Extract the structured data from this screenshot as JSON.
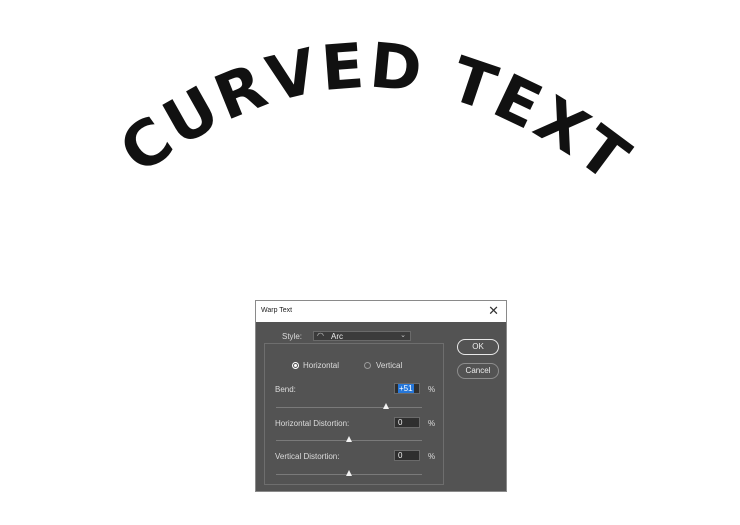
{
  "artwork": {
    "text": "CURVED TEXT",
    "color": "#111111"
  },
  "dialog": {
    "title": "Warp Text",
    "close_icon": "close-icon",
    "style_label": "Style:",
    "style_value": "Arc",
    "style_icon": "arc-icon",
    "orientation": {
      "horizontal_label": "Horizontal",
      "vertical_label": "Vertical",
      "selected": "Horizontal"
    },
    "bend": {
      "label": "Bend:",
      "value": "+51",
      "unit": "%",
      "level": 51
    },
    "horizontal_distortion": {
      "label": "Horizontal Distortion:",
      "value": "0",
      "unit": "%",
      "level": 0
    },
    "vertical_distortion": {
      "label": "Vertical Distortion:",
      "value": "0",
      "unit": "%",
      "level": 0
    },
    "ok_label": "OK",
    "cancel_label": "Cancel",
    "colors": {
      "panel": "#535353",
      "selection": "#2677d9"
    }
  }
}
